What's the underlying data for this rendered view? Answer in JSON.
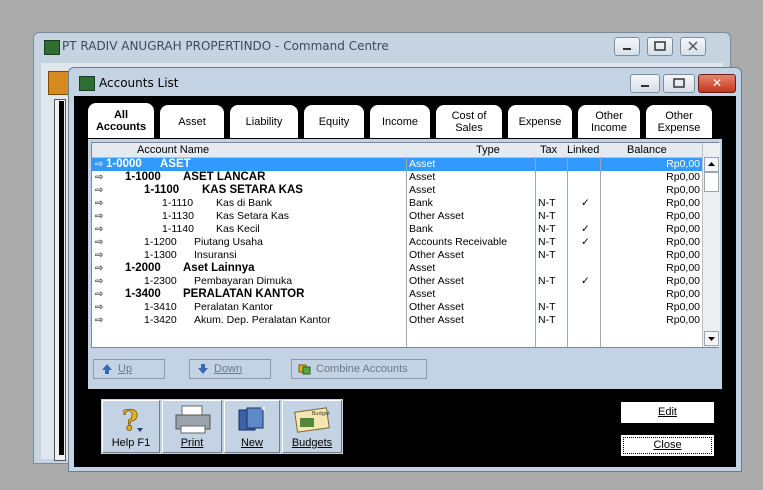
{
  "background_window": {
    "title": "PT RADIV ANUGRAH PROPERTINDO - Command Centre"
  },
  "dialog": {
    "title": "Accounts List",
    "close_glyph": "✕"
  },
  "tabs": [
    {
      "line1": "All",
      "line2": "Accounts",
      "active": true
    },
    {
      "line1": "Asset",
      "line2": ""
    },
    {
      "line1": "Liability",
      "line2": ""
    },
    {
      "line1": "Equity",
      "line2": ""
    },
    {
      "line1": "Income",
      "line2": ""
    },
    {
      "line1": "Cost of",
      "line2": "Sales"
    },
    {
      "line1": "Expense",
      "line2": ""
    },
    {
      "line1": "Other",
      "line2": "Income"
    },
    {
      "line1": "Other",
      "line2": "Expense"
    }
  ],
  "grid": {
    "headers": {
      "name": "Account Name",
      "type": "Type",
      "tax": "Tax",
      "linked": "Linked",
      "balance": "Balance"
    },
    "rows": [
      {
        "number": "1-0000",
        "name": "ASET",
        "level": 0,
        "header": true,
        "type": "Asset",
        "tax": "",
        "linked": "",
        "balance": "Rp0,00",
        "selected": true
      },
      {
        "number": "1-1000",
        "name": "ASET LANCAR",
        "level": 1,
        "header": true,
        "type": "Asset",
        "tax": "",
        "linked": "",
        "balance": "Rp0,00"
      },
      {
        "number": "1-1100",
        "name": "KAS SETARA KAS",
        "level": 2,
        "header": true,
        "type": "Asset",
        "tax": "",
        "linked": "",
        "balance": "Rp0,00"
      },
      {
        "number": "1-1110",
        "name": "Kas di Bank",
        "level": 3,
        "header": false,
        "type": "Bank",
        "tax": "N-T",
        "linked": "✓",
        "balance": "Rp0,00"
      },
      {
        "number": "1-1130",
        "name": "Kas Setara Kas",
        "level": 3,
        "header": false,
        "type": "Other Asset",
        "tax": "N-T",
        "linked": "",
        "balance": "Rp0,00"
      },
      {
        "number": "1-1140",
        "name": "Kas Kecil",
        "level": 3,
        "header": false,
        "type": "Bank",
        "tax": "N-T",
        "linked": "✓",
        "balance": "Rp0,00"
      },
      {
        "number": "1-1200",
        "name": "Piutang Usaha",
        "level": 2,
        "header": false,
        "type": "Accounts Receivable",
        "tax": "N-T",
        "linked": "✓",
        "balance": "Rp0,00"
      },
      {
        "number": "1-1300",
        "name": "Insuransi",
        "level": 2,
        "header": false,
        "type": "Other Asset",
        "tax": "N-T",
        "linked": "",
        "balance": "Rp0,00"
      },
      {
        "number": "1-2000",
        "name": "Aset Lainnya",
        "level": 1,
        "header": true,
        "type": "Asset",
        "tax": "",
        "linked": "",
        "balance": "Rp0,00"
      },
      {
        "number": "1-2300",
        "name": "Pembayaran Dimuka",
        "level": 2,
        "header": false,
        "type": "Other Asset",
        "tax": "N-T",
        "linked": "✓",
        "balance": "Rp0,00"
      },
      {
        "number": "1-3400",
        "name": "PERALATAN KANTOR",
        "level": 1,
        "header": true,
        "type": "Asset",
        "tax": "",
        "linked": "",
        "balance": "Rp0,00"
      },
      {
        "number": "1-3410",
        "name": "Peralatan Kantor",
        "level": 2,
        "header": false,
        "type": "Other Asset",
        "tax": "N-T",
        "linked": "",
        "balance": "Rp0,00"
      },
      {
        "number": "1-3420",
        "name": "Akum. Dep. Peralatan Kantor",
        "level": 2,
        "header": false,
        "type": "Other Asset",
        "tax": "N-T",
        "linked": "",
        "balance": "Rp0,00"
      }
    ]
  },
  "actions": {
    "up": "Up",
    "down": "Down",
    "combine": "Combine Accounts"
  },
  "toolbar": {
    "help": "Help F1",
    "print": "Print",
    "new": "New",
    "budgets": "Budgets",
    "budget_badge": "Budget"
  },
  "buttons": {
    "edit": "Edit",
    "close": "Close"
  }
}
